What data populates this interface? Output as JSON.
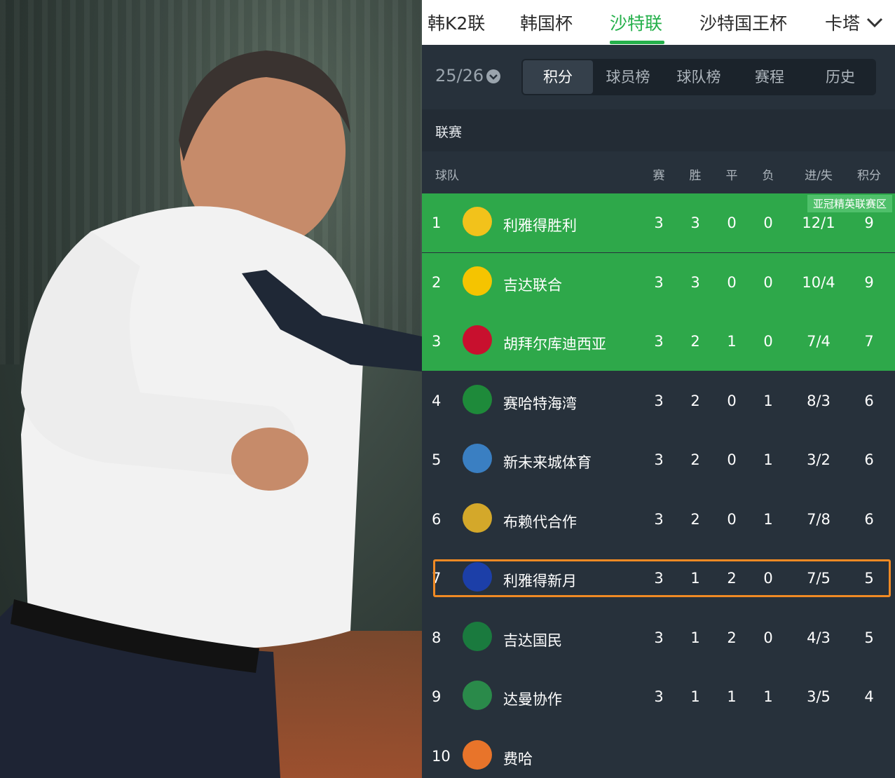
{
  "nav": {
    "tabs": [
      "韩K2联",
      "韩国杯",
      "沙特联",
      "沙特国王杯",
      "卡塔"
    ],
    "active_index": 2
  },
  "season": {
    "label": "25/26"
  },
  "subtabs": {
    "items": [
      "积分",
      "球员榜",
      "球队榜",
      "赛程",
      "历史"
    ],
    "active_index": 0
  },
  "section": {
    "label": "联赛"
  },
  "table": {
    "headers": {
      "team": "球队",
      "played": "赛",
      "won": "胜",
      "draw": "平",
      "lost": "负",
      "goals": "进/失",
      "points": "积分"
    },
    "zone_label": "亚冠精英联赛区",
    "rows": [
      {
        "rank": "1",
        "team": "利雅得胜利",
        "played": "3",
        "won": "3",
        "draw": "0",
        "lost": "0",
        "goals": "12/1",
        "points": "9",
        "zone": true,
        "logo_color": "#f2c21b"
      },
      {
        "rank": "2",
        "team": "吉达联合",
        "played": "3",
        "won": "3",
        "draw": "0",
        "lost": "0",
        "goals": "10/4",
        "points": "9",
        "zone": true,
        "logo_color": "#f5c400"
      },
      {
        "rank": "3",
        "team": "胡拜尔库迪西亚",
        "played": "3",
        "won": "2",
        "draw": "1",
        "lost": "0",
        "goals": "7/4",
        "points": "7",
        "zone": true,
        "logo_color": "#c8102e"
      },
      {
        "rank": "4",
        "team": "赛哈特海湾",
        "played": "3",
        "won": "2",
        "draw": "0",
        "lost": "1",
        "goals": "8/3",
        "points": "6",
        "zone": false,
        "logo_color": "#1e8a3a"
      },
      {
        "rank": "5",
        "team": "新未来城体育",
        "played": "3",
        "won": "2",
        "draw": "0",
        "lost": "1",
        "goals": "3/2",
        "points": "6",
        "zone": false,
        "logo_color": "#3a7fc2"
      },
      {
        "rank": "6",
        "team": "布赖代合作",
        "played": "3",
        "won": "2",
        "draw": "0",
        "lost": "1",
        "goals": "7/8",
        "points": "6",
        "zone": false,
        "logo_color": "#d4a82a"
      },
      {
        "rank": "7",
        "team": "利雅得新月",
        "played": "3",
        "won": "1",
        "draw": "2",
        "lost": "0",
        "goals": "7/5",
        "points": "5",
        "zone": false,
        "logo_color": "#1c3fa8"
      },
      {
        "rank": "8",
        "team": "吉达国民",
        "played": "3",
        "won": "1",
        "draw": "2",
        "lost": "0",
        "goals": "4/3",
        "points": "5",
        "zone": false,
        "logo_color": "#1a7a3e"
      },
      {
        "rank": "9",
        "team": "达曼协作",
        "played": "3",
        "won": "1",
        "draw": "1",
        "lost": "1",
        "goals": "3/5",
        "points": "4",
        "zone": false,
        "logo_color": "#2a8a4a"
      },
      {
        "rank": "10",
        "team": "费哈",
        "played": "",
        "won": "",
        "draw": "",
        "lost": "",
        "goals": "",
        "points": "",
        "zone": false,
        "logo_color": "#e8742a"
      }
    ],
    "highlight_rank": "7"
  },
  "colors": {
    "accent": "#25b04b",
    "zone": "#2ea84a",
    "highlight": "#f08a24",
    "panel": "#27313b"
  }
}
